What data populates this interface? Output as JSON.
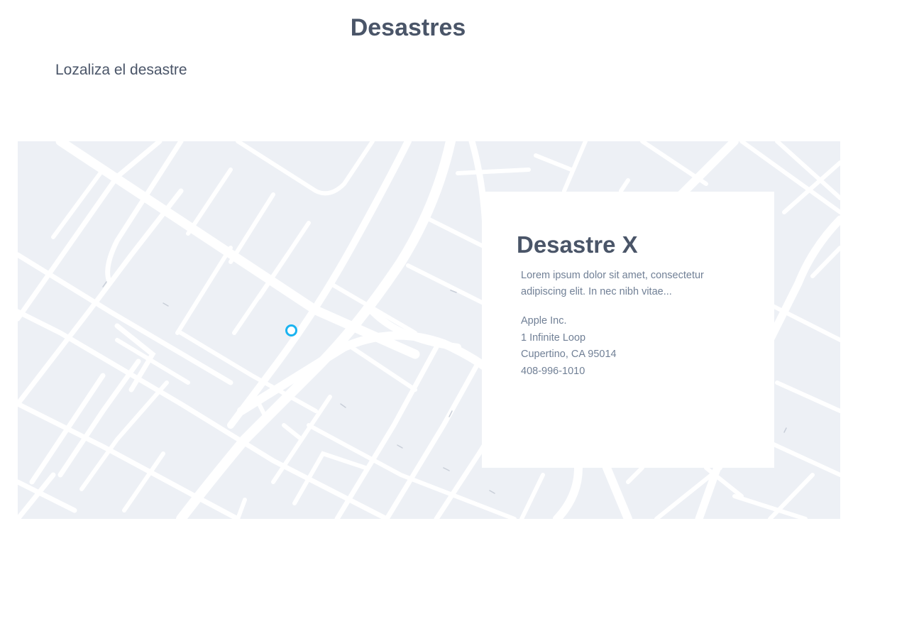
{
  "header": {
    "title": "Desastres",
    "subtitle": "Lozaliza el desastre"
  },
  "map": {
    "background_color": "#edf0f5",
    "road_color": "#ffffff",
    "marker_color": "#1ab3f0"
  },
  "info_card": {
    "title": "Desastre X",
    "description": "Lorem ipsum dolor sit amet, consectetur adipiscing elit. In nec nibh vitae...",
    "address_lines": [
      "Apple Inc.",
      "1 Infinite Loop",
      "Cupertino, CA 95014",
      "408-996-1010"
    ]
  }
}
